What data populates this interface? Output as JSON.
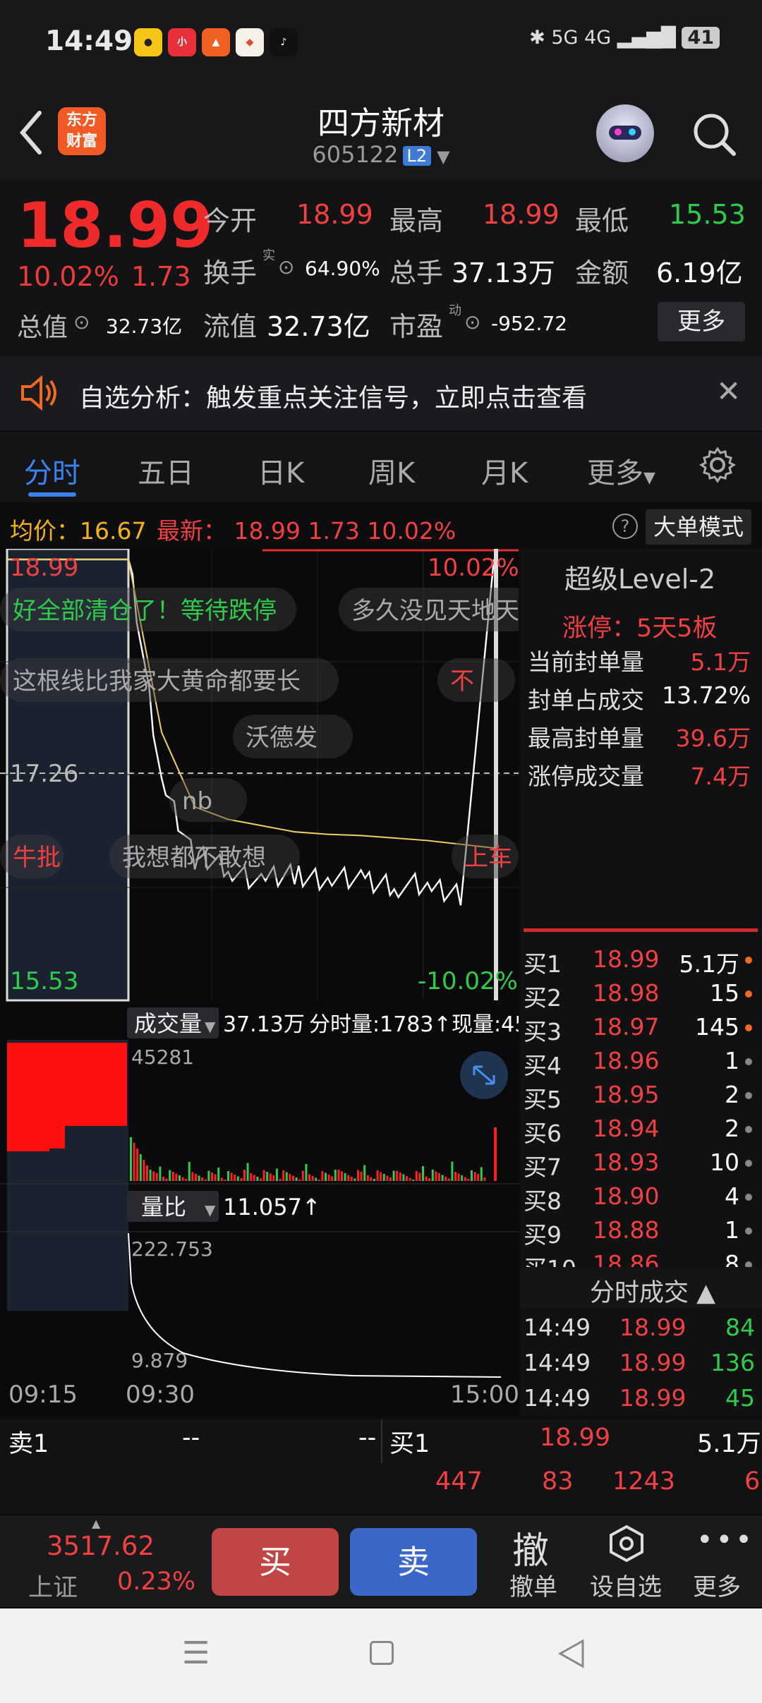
{
  "status": {
    "time": "14:49",
    "signal": "5G 4G",
    "battery": "41"
  },
  "header": {
    "title": "四方新材",
    "code": "605122",
    "level": "L2",
    "logo_line1": "东方",
    "logo_line2": "财富"
  },
  "quote": {
    "price": "18.99",
    "pct": "10.02%",
    "change": "1.73",
    "open_label": "今开",
    "open": "18.99",
    "high_label": "最高",
    "high": "18.99",
    "low_label": "最低",
    "low": "15.53",
    "turnover_label": "换手",
    "turnover_sup": "实",
    "turnover": "64.90%",
    "volume_label": "总手",
    "volume": "37.13万",
    "amount_label": "金额",
    "amount": "6.19亿",
    "mktcap_label": "总值",
    "mktcap": "32.73亿",
    "float_label": "流值",
    "float": "32.73亿",
    "pe_label": "市盈",
    "pe_sup": "动",
    "pe": "-952.72",
    "more": "更多"
  },
  "banner": {
    "text": "自选分析：触发重点关注信号，立即点击查看"
  },
  "tabs": [
    "分时",
    "五日",
    "日K",
    "周K",
    "月K",
    "更多"
  ],
  "avgrow": {
    "avg": "均价：16.67",
    "latest": "最新： 18.99  1.73  10.02%",
    "mode": "大单模式"
  },
  "chart": {
    "top_price": "18.99",
    "top_pct": "10.02%",
    "mid": "17.26",
    "low_price": "15.53",
    "low_pct": "-10.02%",
    "vol_label": "成交量",
    "vol_total": "37.13万",
    "vol_time": "分时量:1783↑",
    "vol_now": "现量:45",
    "vol_max": "45281",
    "ratio_label": "量比",
    "ratio_val": "11.057↑",
    "ratio_max": "222.753",
    "ratio_min": "9.879",
    "times": [
      "09:15",
      "09:30",
      "15:00"
    ],
    "danmu": [
      "好全部清仓了！等待跌停",
      "多久没见天地天",
      "这根线比我家大黄命都要长",
      "不",
      "沃德发",
      "nb",
      "牛批",
      "我想都不敢想",
      "上车"
    ]
  },
  "chart_data": {
    "type": "line",
    "series": [
      {
        "name": "最新",
        "y": [
          18.99,
          18.99,
          17.2,
          16.6,
          16.5,
          16.4,
          16.45,
          16.42,
          16.4,
          16.38,
          16.35,
          16.3,
          18.99
        ]
      },
      {
        "name": "均价",
        "y": [
          18.99,
          18.99,
          17.6,
          17.0,
          16.9,
          16.85,
          16.8,
          16.78,
          16.77,
          16.75,
          16.73,
          16.7,
          16.67
        ]
      }
    ],
    "ylim": [
      15.53,
      18.99
    ]
  },
  "level2": {
    "title": "超级Level-2",
    "limit": "涨停：5天5板",
    "rows": [
      {
        "l": "当前封单量",
        "v": "5.1万"
      },
      {
        "l": "封单占成交",
        "v": "13.72%"
      },
      {
        "l": "最高封单量",
        "v": "39.6万"
      },
      {
        "l": "涨停成交量",
        "v": "7.4万"
      }
    ]
  },
  "orderbook": [
    {
      "l": "买1",
      "p": "18.99",
      "q": "5.1万"
    },
    {
      "l": "买2",
      "p": "18.98",
      "q": "15"
    },
    {
      "l": "买3",
      "p": "18.97",
      "q": "145"
    },
    {
      "l": "买4",
      "p": "18.96",
      "q": "1"
    },
    {
      "l": "买5",
      "p": "18.95",
      "q": "2"
    },
    {
      "l": "买6",
      "p": "18.94",
      "q": "2"
    },
    {
      "l": "买7",
      "p": "18.93",
      "q": "10"
    },
    {
      "l": "买8",
      "p": "18.90",
      "q": "4"
    },
    {
      "l": "买9",
      "p": "18.88",
      "q": "1"
    },
    {
      "l": "买10",
      "p": "18.86",
      "q": "8"
    }
  ],
  "ticks": {
    "title": "分时成交",
    "rows": [
      {
        "t": "14:49",
        "p": "18.99",
        "q": "84"
      },
      {
        "t": "14:49",
        "p": "18.99",
        "q": "136"
      },
      {
        "t": "14:49",
        "p": "18.99",
        "q": "45"
      }
    ]
  },
  "sellrow": {
    "l": "卖1",
    "a": "--",
    "b": "--",
    "buy_l": "买1",
    "buy_p": "18.99",
    "buy_q": "5.1万"
  },
  "numsrow": [
    "447",
    "83",
    "1243",
    "6"
  ],
  "bottom": {
    "index_val": "3517.62",
    "index_name": "上证",
    "index_pct": "0.23%",
    "buy": "买",
    "sell": "卖",
    "cancel_icon": "撤",
    "cancel": "撤单",
    "watch": "设自选",
    "more": "更多"
  }
}
